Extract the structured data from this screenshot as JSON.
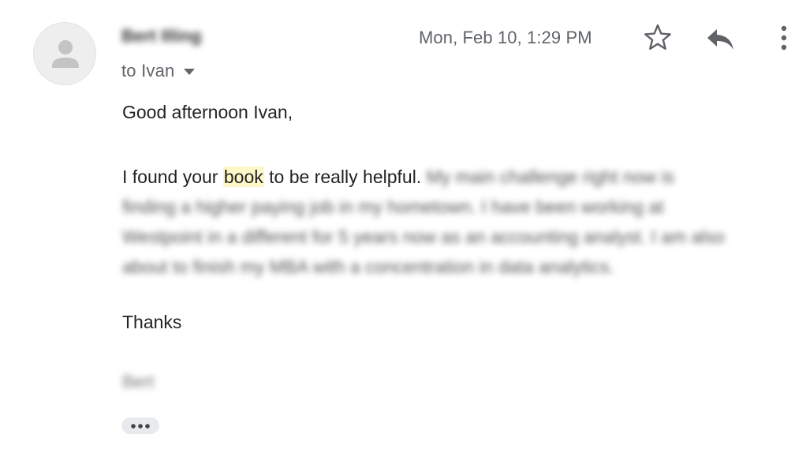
{
  "message": {
    "sender_name": "Bert Illing",
    "avatar_icon": "person-placeholder-icon",
    "recipient_prefix": "to",
    "recipient_name": "Ivan",
    "date": "Mon, Feb 10, 1:29 PM",
    "icons": {
      "star": "star-outline-icon",
      "reply": "reply-icon",
      "more": "more-vert-icon",
      "expand": "chevron-down-icon",
      "trimmed": "more-horiz-icon"
    },
    "body": {
      "greeting": "Good afternoon Ivan,",
      "line1_before": "I found your ",
      "line1_highlight": "book",
      "line1_after": " to be really helpful.",
      "line1_blurred": " My main challenge right now is",
      "blurred_lines": [
        "finding a higher paying job in my hometown. I have been working at",
        "Westpoint in a different for 5 years now as an accounting analyst. I am also",
        "about to finish my MBA with a concentration in data analytics."
      ],
      "closing": "Thanks",
      "signature": "Bert"
    }
  },
  "colors": {
    "highlight": "#fef7c8",
    "secondary_text": "#5f6368",
    "primary_text": "#222222"
  }
}
